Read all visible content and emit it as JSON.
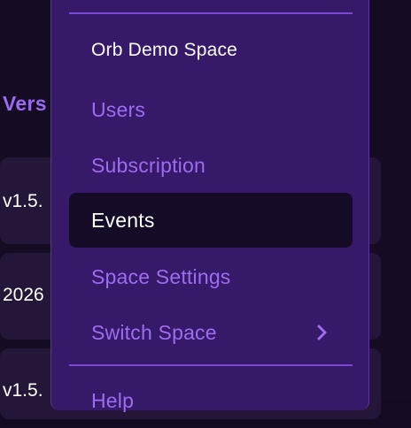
{
  "background": {
    "column_header": "Vers",
    "rows": [
      {
        "value": "v1.5."
      },
      {
        "value": "2026"
      },
      {
        "value": "v1.5."
      }
    ]
  },
  "menu": {
    "space_name": "Orb Demo Space",
    "items": [
      {
        "label": "Users",
        "active": false
      },
      {
        "label": "Subscription",
        "active": false
      },
      {
        "label": "Events",
        "active": true
      },
      {
        "label": "Space Settings",
        "active": false
      },
      {
        "label": "Switch Space",
        "active": false,
        "icon": "chevron-right-icon"
      }
    ],
    "help_label": "Help"
  },
  "colors": {
    "menu_bg": "#361968",
    "accent": "#9d6cf1",
    "active_bg": "#160b27",
    "text_white": "#ffffff"
  }
}
